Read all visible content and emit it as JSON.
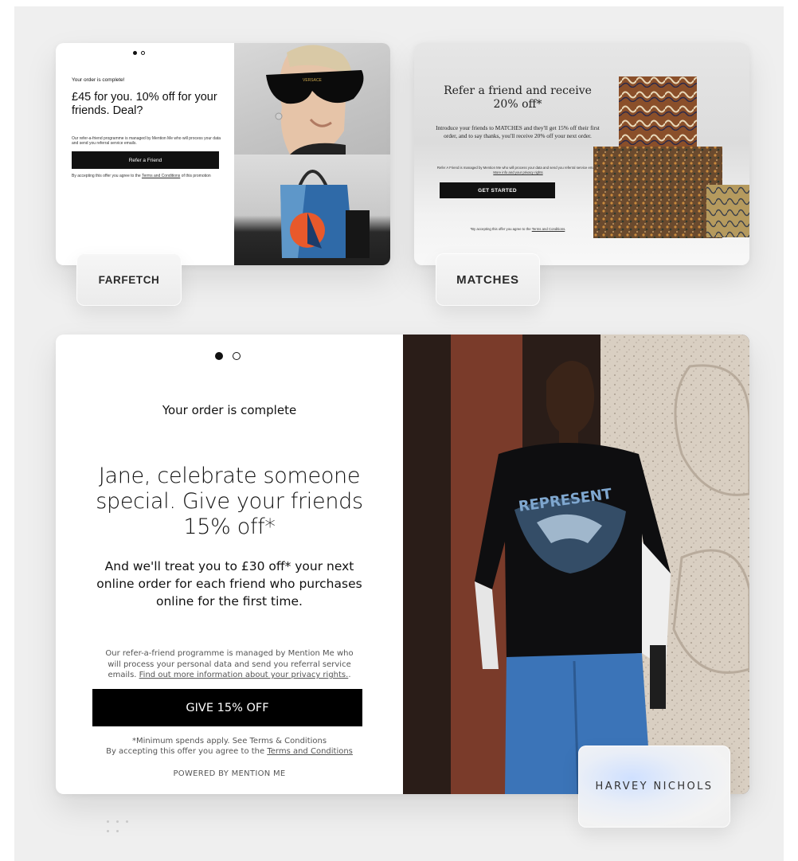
{
  "farfetch": {
    "order_complete": "Your order is complete!",
    "headline": "£45 for you. 10% off for your friends. Deal?",
    "programme_note": "Our refer-a-friend programme is managed by Mention Me who will process your data and send you referral service emails.",
    "button_label": "Refer a Friend",
    "terms_prefix": "By accepting this offer you agree to the",
    "terms_link": "Terms and Conditions",
    "terms_suffix": "of this promotion",
    "brand": "FARFETCH",
    "sunglasses_logo": "VERSACE"
  },
  "matches": {
    "title": "Refer a friend and receive 20% off*",
    "body": "Introduce your friends to MATCHES and they'll get 15% off their first order, and to say thanks, you'll receive 20% off your next order.",
    "fine_print": "Refer A Friend is managed by Mention Me who will process your data and send you referral service emails.",
    "fine_link": "More info and your privacy rights",
    "button_label": "GET STARTED",
    "accept_prefix": "*By accepting this offer you agree to the",
    "accept_link": "Terms and Conditions",
    "accept_suffix": ".",
    "brand": "MATCHES"
  },
  "harvey_nichols": {
    "order_complete": "Your order is complete",
    "headline": "Jane, celebrate someone special. Give your friends 15% off*",
    "subhead": "And we'll treat you to £30 off* your next online order for each friend who purchases online for the first time.",
    "programme_note": "Our refer-a-friend programme is managed by Mention Me who will process your personal data and send you referral service emails.",
    "privacy_link": "Find out more information about your privacy rights.",
    "privacy_suffix": ".",
    "button_label": "GIVE 15% OFF",
    "min_spend": "*Minimum spends apply. See Terms & Conditions",
    "accept_prefix": "By accepting this offer you agree to the",
    "accept_link": "Terms and Conditions",
    "powered_by": "POWERED BY MENTION ME",
    "brand": "HARVEY NICHOLS",
    "shirt_print": "REPRESENT"
  },
  "colors": {
    "button_bg": "#000000",
    "card_bg": "#ffffff",
    "backdrop": "#efefef",
    "chip_glow": "#cfe0ff"
  },
  "icons": [
    "carousel-dot-active",
    "carousel-dot-inactive"
  ]
}
